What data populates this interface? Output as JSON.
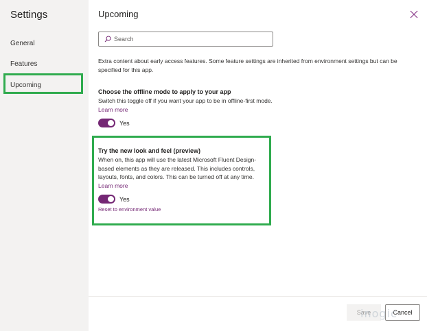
{
  "sidebar": {
    "title": "Settings",
    "items": [
      {
        "label": "General"
      },
      {
        "label": "Features"
      },
      {
        "label": "Upcoming"
      }
    ]
  },
  "main": {
    "title": "Upcoming",
    "search": {
      "placeholder": "Search"
    },
    "description": "Extra content about early access features. Some feature settings are inherited from environment settings but can be specified for this app.",
    "offline": {
      "title": "Choose the offline mode to apply to your app",
      "text": "Switch this toggle off if you want your app to be in offline-first mode.",
      "link": "Learn more",
      "toggle_label": "Yes",
      "toggle_on": true
    },
    "new_look": {
      "title": "Try the new look and feel (preview)",
      "text": "When on, this app will use the latest Microsoft Fluent Design-based elements as they are released. This includes controls, layouts, fonts, and colors. This can be turned off at any time.",
      "link": "Learn more",
      "toggle_label": "Yes",
      "toggle_on": true,
      "reset_link": "Reset to environment value"
    }
  },
  "footer": {
    "save_label": "Save",
    "cancel_label": "Cancel"
  },
  "watermark": "inogic",
  "colors": {
    "accent": "#742774",
    "highlight": "#2fab4e",
    "sidebar_bg": "#f3f2f1"
  }
}
